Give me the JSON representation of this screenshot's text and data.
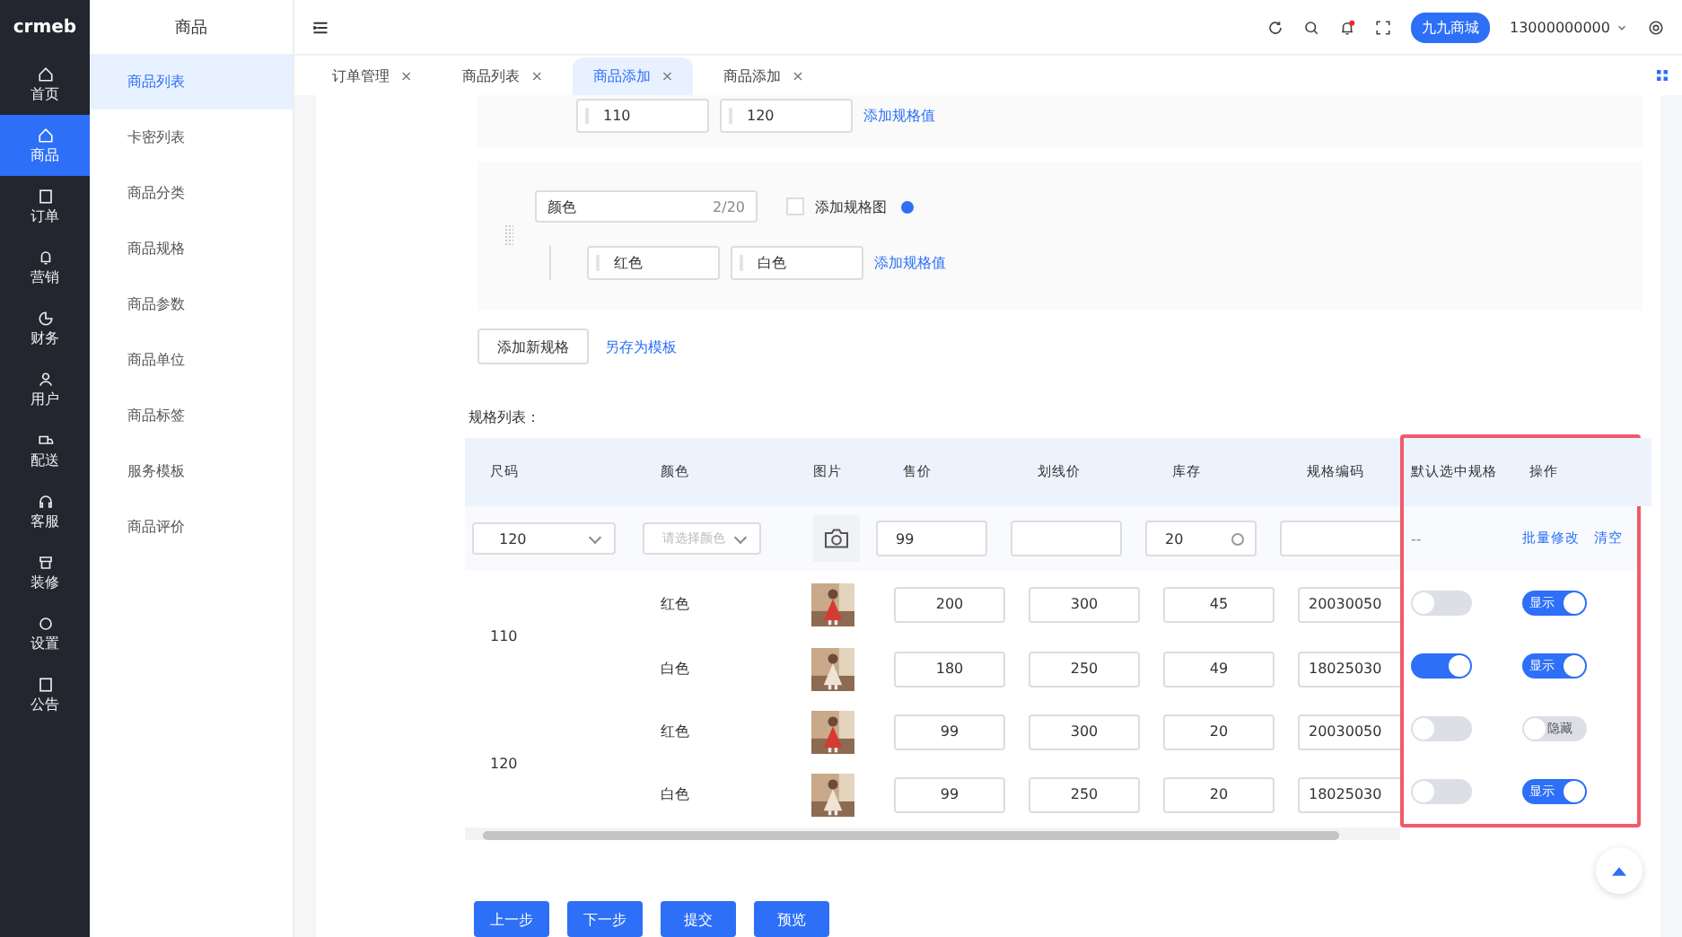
{
  "logo": "crmeb",
  "main_nav": [
    {
      "label": "首页",
      "selected": false
    },
    {
      "label": "商品",
      "selected": true
    },
    {
      "label": "订单",
      "selected": false
    },
    {
      "label": "营销",
      "selected": false
    },
    {
      "label": "财务",
      "selected": false
    },
    {
      "label": "用户",
      "selected": false
    },
    {
      "label": "配送",
      "selected": false
    },
    {
      "label": "客服",
      "selected": false
    },
    {
      "label": "装修",
      "selected": false
    },
    {
      "label": "设置",
      "selected": false
    },
    {
      "label": "公告",
      "selected": false
    }
  ],
  "sub_nav": {
    "title": "商品",
    "items": [
      {
        "label": "商品列表",
        "selected": true
      },
      {
        "label": "卡密列表",
        "selected": false
      },
      {
        "label": "商品分类",
        "selected": false
      },
      {
        "label": "商品规格",
        "selected": false
      },
      {
        "label": "商品参数",
        "selected": false
      },
      {
        "label": "商品单位",
        "selected": false
      },
      {
        "label": "商品标签",
        "selected": false
      },
      {
        "label": "服务模板",
        "selected": false
      },
      {
        "label": "商品评价",
        "selected": false
      }
    ]
  },
  "header": {
    "notification": true,
    "store": "九九商城",
    "user": "13000000000"
  },
  "tabs": [
    {
      "label": "订单管理",
      "close": "×",
      "selected": false
    },
    {
      "label": "商品列表",
      "close": "×",
      "selected": false
    },
    {
      "label": "商品添加",
      "close": "×",
      "selected": true
    },
    {
      "label": "商品添加",
      "close": "×",
      "selected": false
    }
  ],
  "spec_groups": [
    {
      "values": [
        "110",
        "120"
      ],
      "add_value": "添加规格值"
    },
    {
      "name": "颜色",
      "counter": "2/20",
      "add_image": {
        "label": "添加规格图",
        "checked": false
      },
      "values": [
        "红色",
        "白色"
      ],
      "add_value": "添加规格值"
    }
  ],
  "add_spec_button": "添加新规格",
  "save_template_link": "另存为模板",
  "table": {
    "title": "规格列表：",
    "highlighted": true,
    "columns": [
      "尺码",
      "颜色",
      "图片",
      "售价",
      "划线价",
      "库存",
      "规格编码",
      "默认选中规格",
      "操作"
    ],
    "batch": {
      "size": "120",
      "color_placeholder": "请选择颜色",
      "price": "99",
      "stock": "20",
      "default": "--",
      "actions": [
        "批量修改",
        "清空"
      ]
    },
    "groups": [
      {
        "size": "110",
        "rows": [
          {
            "variant": "红色",
            "price": "200",
            "original_price": "300",
            "stock": "45",
            "code": "20030050",
            "default_on": false,
            "visible": {
              "on": true,
              "label": "显示"
            }
          },
          {
            "variant": "白色",
            "price": "180",
            "original_price": "250",
            "stock": "49",
            "code": "18025030",
            "default_on": true,
            "visible": {
              "on": true,
              "label": "显示"
            }
          }
        ]
      },
      {
        "size": "120",
        "rows": [
          {
            "variant": "红色",
            "price": "99",
            "original_price": "300",
            "stock": "20",
            "code": "20030050",
            "default_on": false,
            "visible": {
              "on": false,
              "label": "隐藏"
            }
          },
          {
            "variant": "白色",
            "price": "99",
            "original_price": "250",
            "stock": "20",
            "code": "18025030",
            "default_on": false,
            "visible": {
              "on": true,
              "label": "显示"
            }
          }
        ]
      }
    ]
  },
  "footer_buttons": [
    "上一步",
    "下一步",
    "提交",
    "预览"
  ]
}
